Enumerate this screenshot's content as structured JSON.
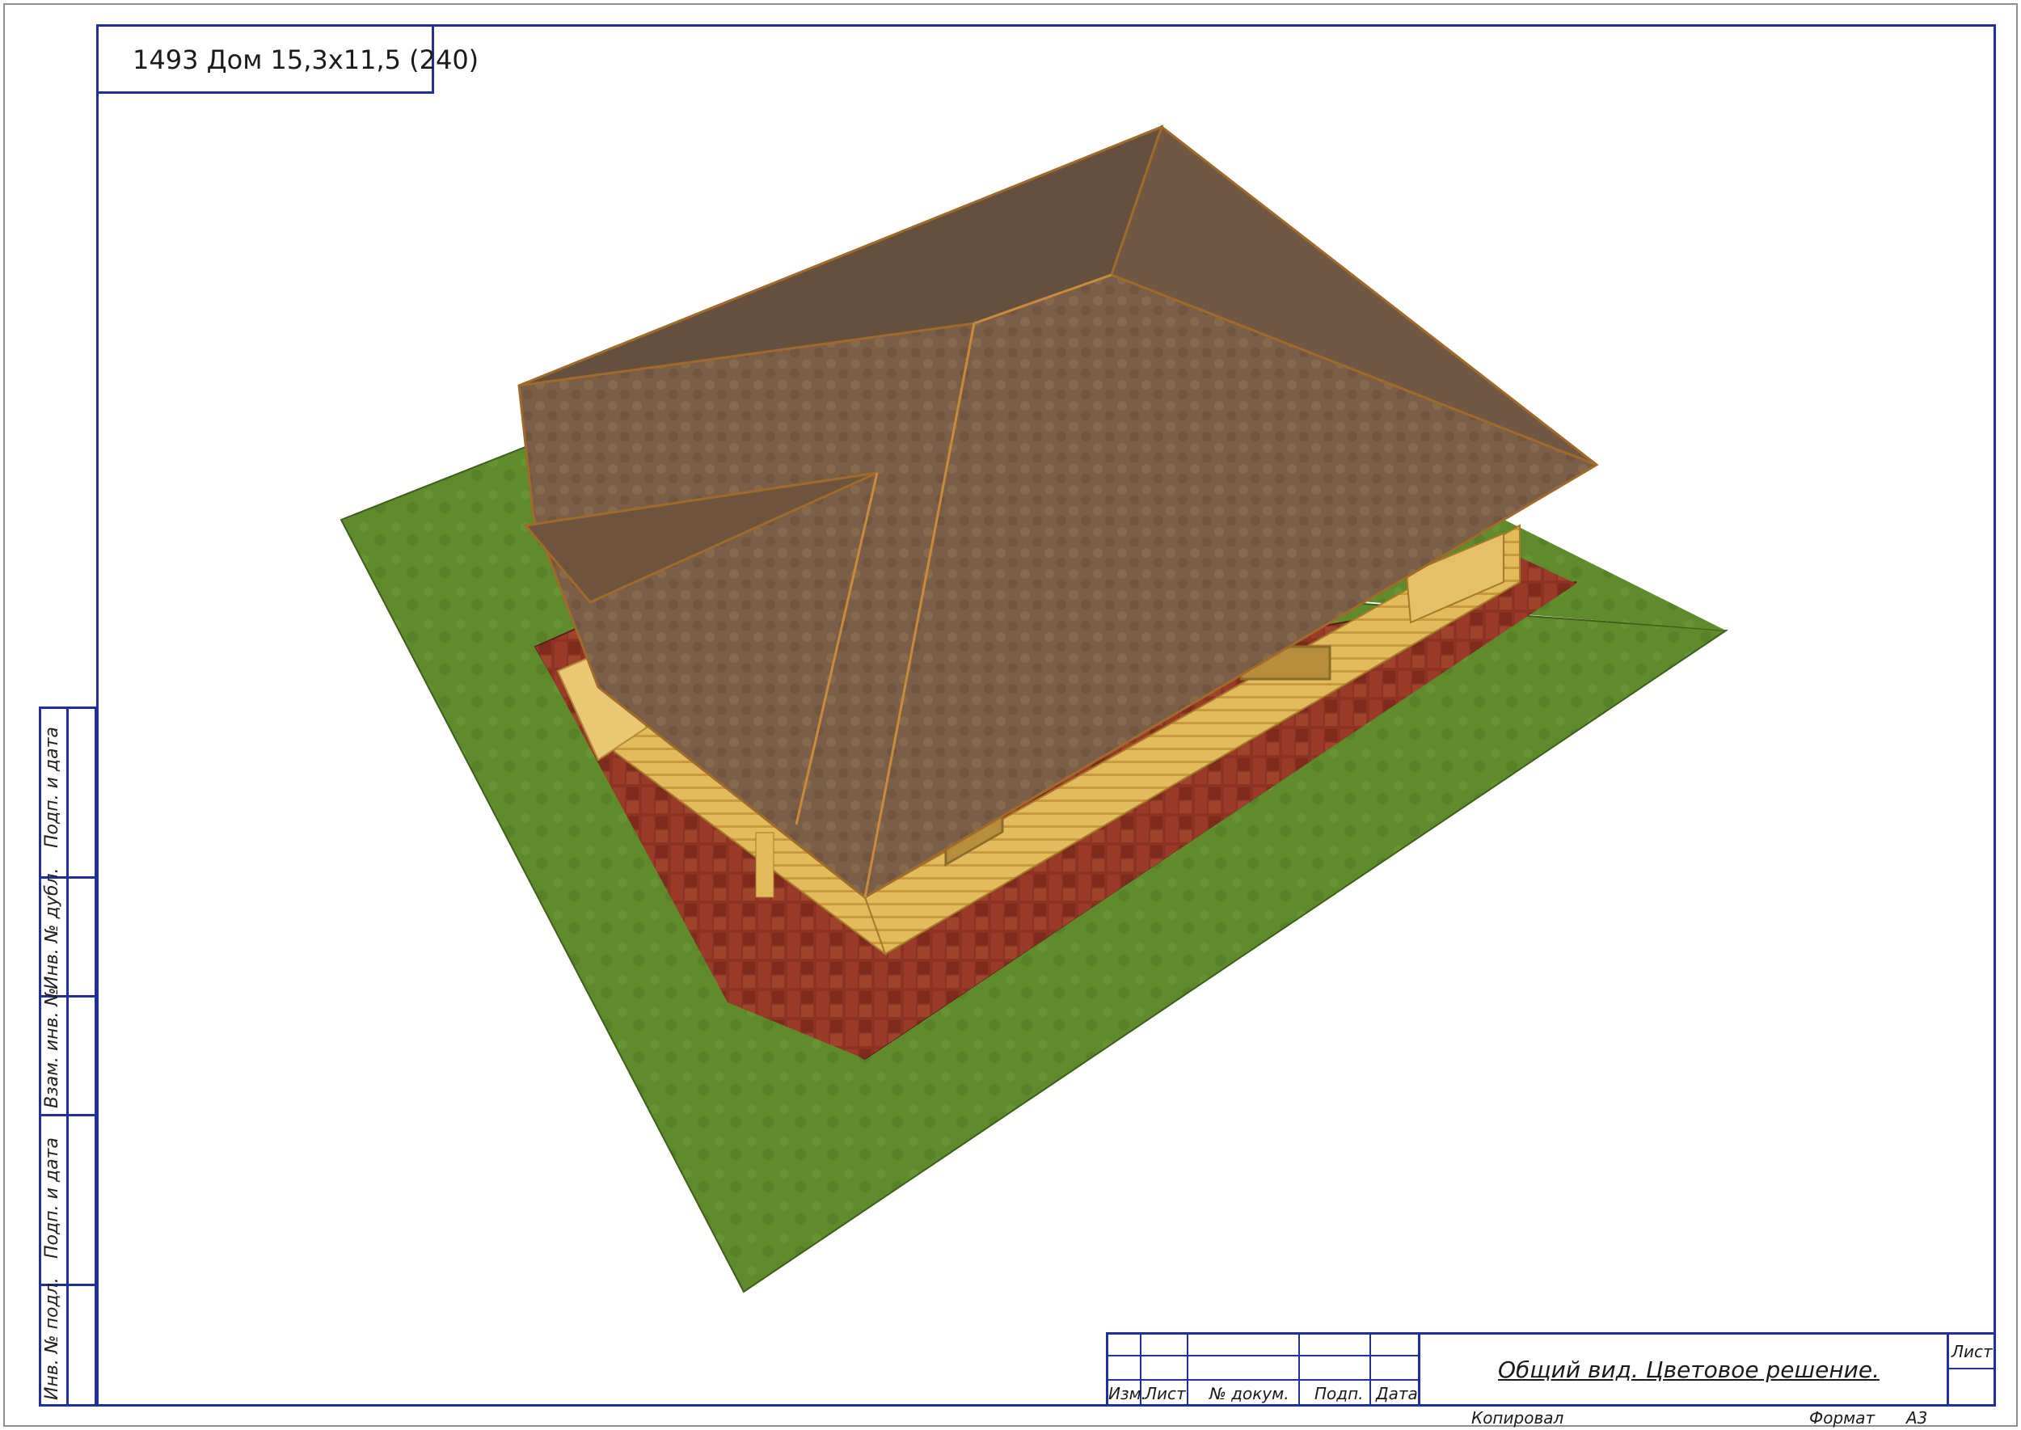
{
  "drawing": {
    "title": "1493 Дом 15,3х11,5 (240)"
  },
  "side_stamp": {
    "labels": [
      "Подп. и дата",
      "Инв. № дубл.",
      "Взам. инв. №",
      "Подп. и дата",
      "Инв. № подл."
    ]
  },
  "title_block": {
    "columns": [
      "Изм.",
      "Лист",
      "№ докум.",
      "Подп.",
      "Дата"
    ],
    "sheet_title": "Общий вид. Цветовое решение.",
    "sheet_label": "Лист",
    "copied_label": "Копировал",
    "format_label": "Формат",
    "format_value": "А3"
  },
  "render": {
    "description_icon": "house-3d-render",
    "colors": {
      "grass": "#5e8a2c",
      "paving": "#8a2f22",
      "roof": "#7a5c45",
      "wood": "#e0b85a",
      "frame": "#1f2f9e"
    }
  }
}
